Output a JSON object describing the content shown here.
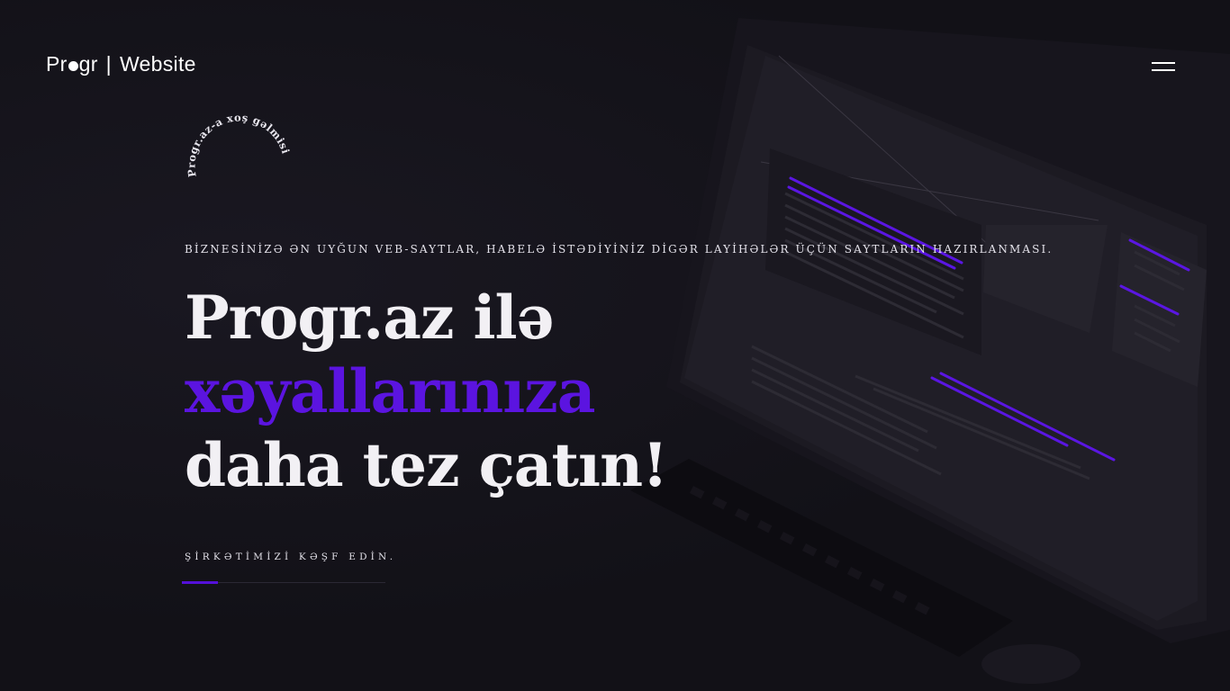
{
  "header": {
    "logo_prefix": "Pr",
    "logo_suffix": "gr",
    "logo_separator": "|",
    "logo_site": "Website",
    "menu_icon": "hamburger-menu-icon"
  },
  "badge": {
    "arc_text": "Progr.az-a xoş gəlmisiz!"
  },
  "hero": {
    "tagline": "BİZNESİNİZƏ ƏN UYĞUN VEB-SAYTLAR, HABELƏ İSTƏDİYİNİZ DİGƏR LAYİHƏLƏR ÜÇÜN SAYTLARIN HAZIRLANMASI.",
    "headline_line1": "Progr.az ilə",
    "headline_line2": "xəyallarınıza",
    "headline_line3": "daha tez çatın!",
    "cta_label": "ŞİRKƏTİMİZİ KƏŞF EDİN."
  },
  "colors": {
    "background": "#121117",
    "accent": "#5b14e0",
    "text": "#f2f0f4"
  }
}
